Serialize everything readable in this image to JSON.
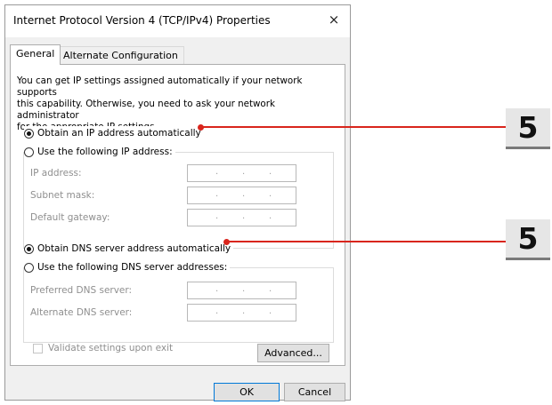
{
  "dialog": {
    "title": "Internet Protocol Version 4 (TCP/IPv4) Properties",
    "close_glyph": "×"
  },
  "tabs": [
    {
      "label": "General",
      "active": true
    },
    {
      "label": "Alternate Configuration",
      "active": false
    }
  ],
  "description": "You can get IP settings assigned automatically if your network supports\nthis capability. Otherwise, you need to ask your network administrator\nfor the appropriate IP settings.",
  "ip": {
    "auto_label": "Obtain an IP address automatically",
    "auto_selected": true,
    "manual_label": "Use the following IP address:",
    "fields": [
      {
        "label": "IP address:",
        "value": ". . ."
      },
      {
        "label": "Subnet mask:",
        "value": ". . ."
      },
      {
        "label": "Default gateway:",
        "value": ". . ."
      }
    ]
  },
  "dns": {
    "auto_label": "Obtain DNS server address automatically",
    "auto_selected": true,
    "manual_label": "Use the following DNS server addresses:",
    "fields": [
      {
        "label": "Preferred DNS server:",
        "value": ". . ."
      },
      {
        "label": "Alternate DNS server:",
        "value": ". . ."
      }
    ]
  },
  "validate_label": "Validate settings upon exit",
  "buttons": {
    "advanced": "Advanced...",
    "ok": "OK",
    "cancel": "Cancel"
  },
  "annotations": [
    {
      "label": "5"
    },
    {
      "label": "5"
    }
  ],
  "colors": {
    "annotation_red": "#d9251c",
    "focus_blue": "#0078d7"
  }
}
